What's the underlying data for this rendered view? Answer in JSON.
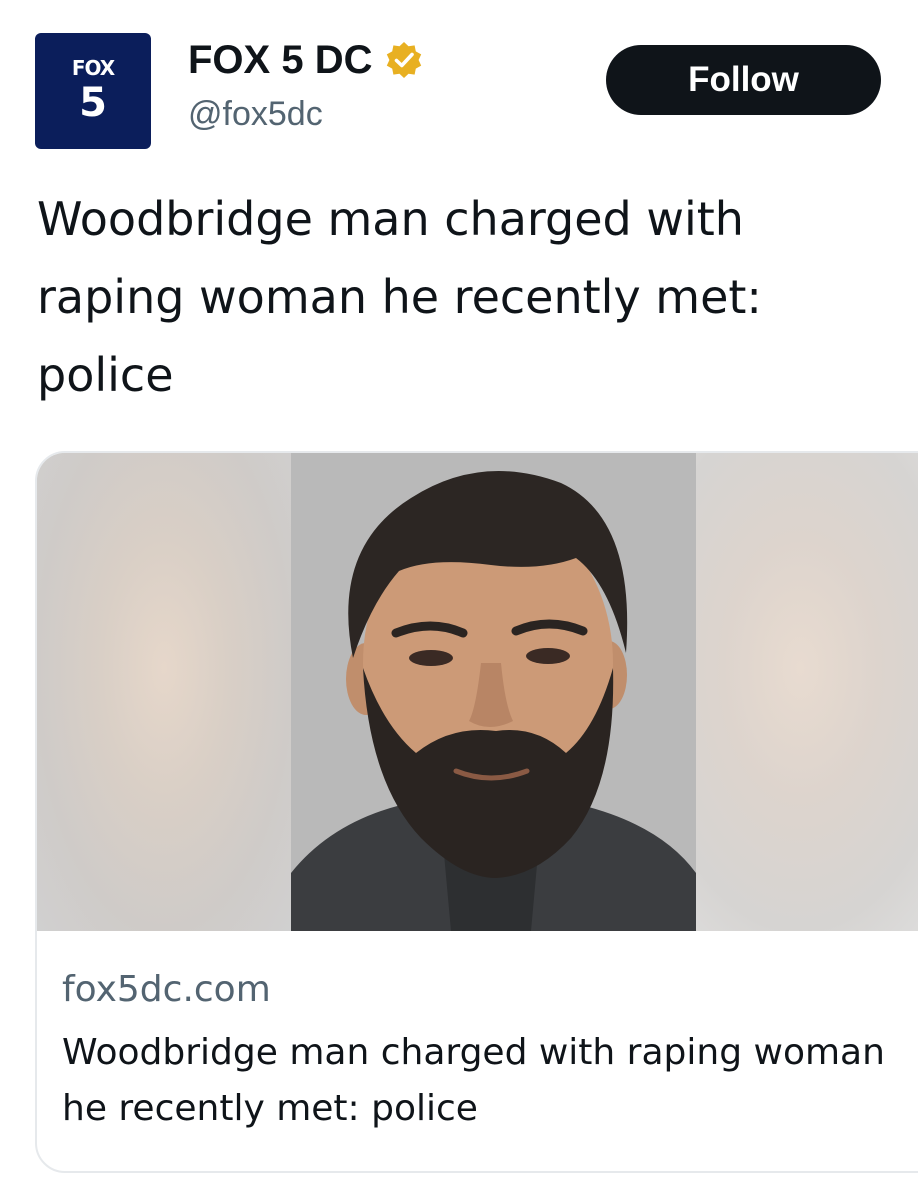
{
  "account": {
    "logo_top": "FOX",
    "logo_bottom": "5",
    "display_name": "FOX 5 DC",
    "handle": "@fox5dc",
    "verified_icon": "verified-badge-icon",
    "logo_color": "#0b1e5b",
    "badge_color": "#e8b022"
  },
  "actions": {
    "follow_label": "Follow"
  },
  "tweet": {
    "text": "Woodbridge man charged with raping woman he recently met: police"
  },
  "link_card": {
    "domain": "fox5dc.com",
    "title": "Woodbridge man charged with raping woman he recently met: police",
    "image": "mugshot-photo"
  }
}
